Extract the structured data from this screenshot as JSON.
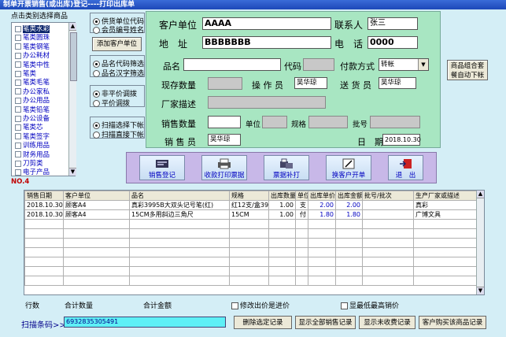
{
  "window": {
    "title": "制单开票销售(或出库)登记----打印出库单"
  },
  "category": {
    "header": "点击类别选择商品",
    "items": [
      "笔类水彩",
      "笔类圆珠",
      "笔类钢笔",
      "办公耗材",
      "笔类中性",
      "笔类",
      "笔类毛笔",
      "办公家私",
      "办公用品",
      "笔类铅笔",
      "办公设备",
      "笔类芯",
      "笔类签字",
      "训练用品",
      "财务用品",
      "刀剪类",
      "电子产品"
    ],
    "selected_index": 0,
    "count": "NO.4"
  },
  "options": {
    "supplier_code": "供货单位代码",
    "member_name": "会员编号姓名",
    "add_customer": "添加客户单位",
    "prod_code_filter": "品名代码筛选",
    "prod_chinese_filter": "品名汉字筛选",
    "non_avg_adjust": "非平价调拨",
    "avg_adjust": "平价调拨",
    "scan_select": "扫描选择下帐",
    "scan_direct": "扫描直接下帐"
  },
  "form": {
    "customer_label": "客户单位",
    "customer_value": "AAAA",
    "contact_label": "联系人",
    "contact_value": "张三",
    "address_label": "地　址",
    "address_value": "BBBBBBB",
    "phone_label": "电　话",
    "phone_value": "0000",
    "product_label": "品名",
    "product_value": "",
    "code_label": "代码",
    "pay_label": "付款方式",
    "pay_value": "转帐",
    "stock_label": "现存数量",
    "operator_label": "操 作 员",
    "operator_value": "吴华琼",
    "deliverer_label": "送 货 员",
    "deliverer_value": "吴华琼",
    "vendor_label": "厂家描述",
    "qty_label": "销售数量",
    "unit_label": "单位",
    "spec_label": "规格",
    "batch_label": "批号",
    "seller_label": "销 售 员",
    "seller_value": "吴华琼",
    "date_label": "日　期",
    "date_value": "2018.10.30",
    "side_button": "商品组合套餐自动下帐"
  },
  "toolbar": {
    "sales_register": "销售登记",
    "receipt_print": "收款打印票据",
    "reprint": "票据补打",
    "change_customer": "换客户开单",
    "exit": "退　出"
  },
  "grid": {
    "headers": [
      "销售日期",
      "客户单位",
      "品名",
      "规格",
      "出库数量",
      "单位",
      "出库单价",
      "出库金额",
      "批号/批次",
      "生产厂家或描述"
    ],
    "rows": [
      [
        "2018.10.30",
        "顾客A4",
        "真彩3995B大双头记号笔(红)",
        "红12支/盒39",
        "1.00",
        "支",
        "2.00",
        "2.00",
        "",
        "真彩"
      ],
      [
        "2018.10.30",
        "顾客A4",
        "15CM多用斜边三角尺",
        "15CM",
        "1.00",
        "付",
        "1.80",
        "1.80",
        "",
        "广博文具"
      ]
    ]
  },
  "footer": {
    "rows_label": "行数",
    "total_qty_label": "合计数量",
    "total_amount_label": "合计金额",
    "modify_price": "修改出价是进价",
    "show_lowest": "显最低最高销价",
    "barcode_label": "扫描条码>>",
    "barcode_value": "6932835305491",
    "btn_delete": "删除选定记录",
    "btn_show_all": "显示全部销售记录",
    "btn_unpaid": "显示未收费记录",
    "btn_customer_history": "客户购买该商品记录"
  }
}
